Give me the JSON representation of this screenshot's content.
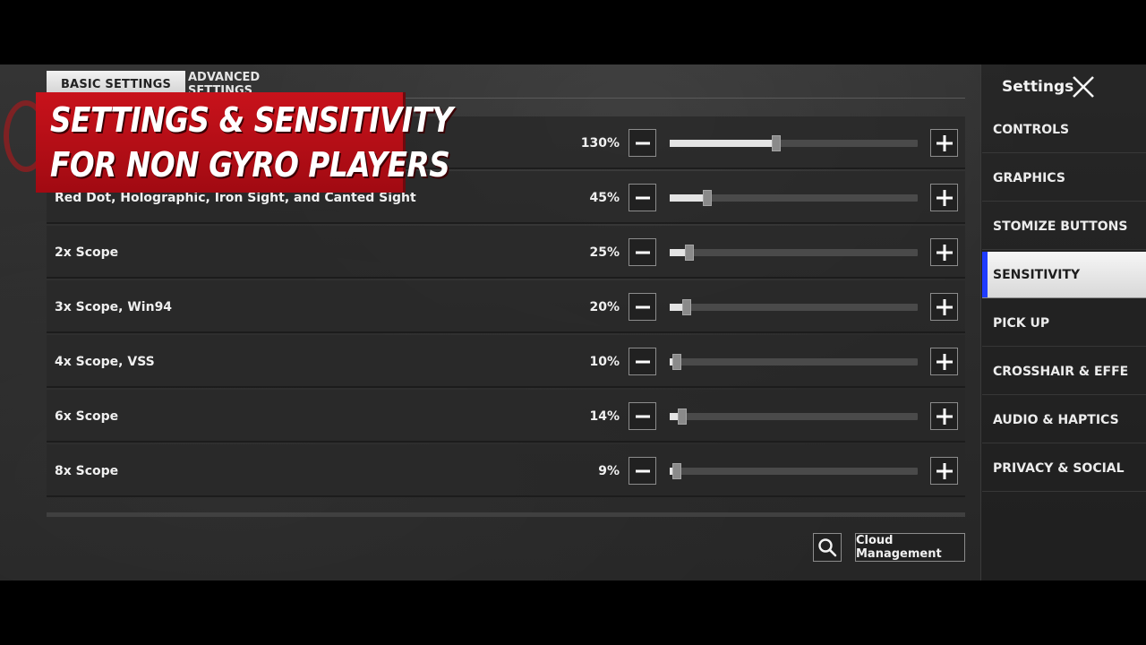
{
  "tabs": {
    "basic": "BASIC SETTINGS",
    "advanced": "ADVANCED SETTINGS"
  },
  "banner": {
    "line1": "SETTINGS & SENSITIVITY",
    "line2": "FOR NON GYRO PLAYERS"
  },
  "rows": [
    {
      "label": "",
      "value": "130%",
      "level": 0.43
    },
    {
      "label": "Red Dot, Holographic, Iron Sight, and Canted Sight",
      "value": "45%",
      "level": 0.15
    },
    {
      "label": "2x Scope",
      "value": "25%",
      "level": 0.08
    },
    {
      "label": "3x Scope, Win94",
      "value": "20%",
      "level": 0.07
    },
    {
      "label": "4x Scope, VSS",
      "value": "10%",
      "level": 0.03
    },
    {
      "label": "6x Scope",
      "value": "14%",
      "level": 0.05
    },
    {
      "label": "8x Scope",
      "value": "9%",
      "level": 0.03
    }
  ],
  "controls": {
    "minus_icon": "minus-icon",
    "plus_icon": "plus-icon",
    "cloud_label": "Cloud Management",
    "search_icon": "search-icon"
  },
  "sidebar": {
    "title": "Settings",
    "close_icon": "close-icon",
    "items": [
      {
        "label": "CONTROLS",
        "active": false
      },
      {
        "label": "GRAPHICS",
        "active": false
      },
      {
        "label": "STOMIZE BUTTONS",
        "active": false
      },
      {
        "label": "SENSITIVITY",
        "active": true
      },
      {
        "label": "PICK UP",
        "active": false
      },
      {
        "label": "CROSSHAIR & EFFE",
        "active": false
      },
      {
        "label": "AUDIO & HAPTICS",
        "active": false
      },
      {
        "label": "PRIVACY & SOCIAL",
        "active": false
      }
    ]
  },
  "colors": {
    "banner_red": "#c8121b",
    "active_accent": "#1f3cff",
    "slider_fill": "#e4e4e4"
  }
}
